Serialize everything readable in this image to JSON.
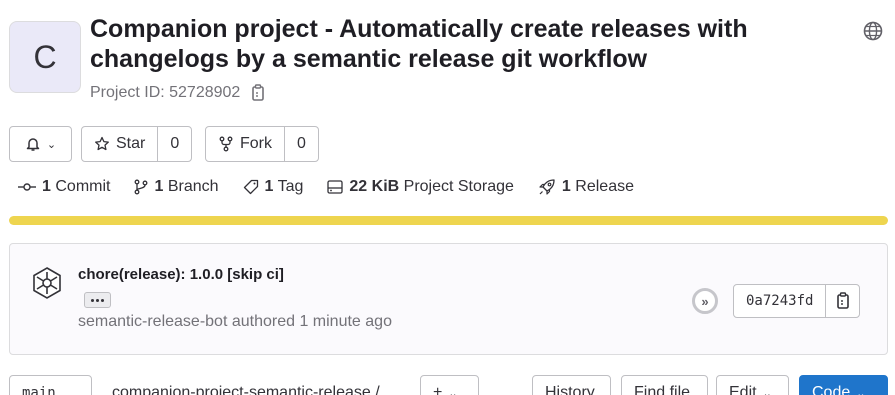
{
  "project": {
    "avatar_letter": "C",
    "title": "Companion project - Automatically create releases with changelogs by a semantic release git workflow",
    "id_text": "Project ID: 52728902"
  },
  "actions": {
    "notification_label": "",
    "star_label": "Star",
    "star_count": "0",
    "fork_label": "Fork",
    "fork_count": "0"
  },
  "stats": [
    {
      "count": "1",
      "label": "Commit",
      "icon": "commit-icon"
    },
    {
      "count": "1",
      "label": "Branch",
      "icon": "branch-icon"
    },
    {
      "count": "1",
      "label": "Tag",
      "icon": "tag-icon"
    },
    {
      "count": "22 KiB",
      "label": "Project Storage",
      "icon": "storage-icon"
    },
    {
      "count": "1",
      "label": "Release",
      "icon": "rocket-icon"
    }
  ],
  "storage_usage": {
    "fraction": 1.0,
    "color": "#eed54f"
  },
  "last_commit": {
    "title": "chore(release): 1.0.0 [skip ci]",
    "meta": "semantic-release-bot authored 1 minute ago",
    "sha": "0a7243fd",
    "pipeline_symbol": "»"
  },
  "toolbar": {
    "branch": "main",
    "path": "companion-project-semantic-release /",
    "add_label": "+",
    "history_label": "History",
    "find_file_label": "Find file",
    "edit_label": "Edit",
    "code_label": "Code"
  },
  "colors": {
    "accent": "#1f75cb",
    "warning_bar": "#eed54f"
  }
}
